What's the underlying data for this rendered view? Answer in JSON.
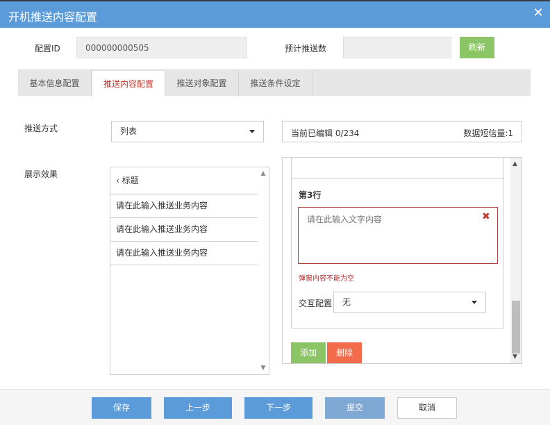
{
  "dialog": {
    "title": "开机推送内容配置"
  },
  "config": {
    "id_label": "配置ID",
    "id_value": "000000000505",
    "estimate_label": "预计推送数",
    "estimate_value": "",
    "refresh_label": "刷新"
  },
  "tabs": [
    {
      "label": "基本信息配置",
      "active": false
    },
    {
      "label": "推送内容配置",
      "active": true
    },
    {
      "label": "推送对象配置",
      "active": false
    },
    {
      "label": "推送条件设定",
      "active": false
    }
  ],
  "push_method": {
    "label": "推送方式",
    "selected": "列表"
  },
  "status": {
    "edited": "当前已编辑 0/234",
    "sms_count": "数据短信量:1"
  },
  "preview": {
    "label": "展示效果",
    "back_title": "‹ 标题",
    "rows": [
      "请在此输入推送业务内容",
      "请在此输入推送业务内容",
      "请在此输入推送业务内容"
    ]
  },
  "editor": {
    "row_title": "第3行",
    "placeholder": "请在此输入文字内容",
    "error": "弹窗内容不能为空",
    "interaction_label": "交互配置",
    "interaction_selected": "无",
    "add_label": "添加",
    "delete_label": "删除"
  },
  "footer": {
    "save": "保存",
    "prev": "上一步",
    "next": "下一步",
    "submit": "提交",
    "cancel": "取消"
  },
  "colors": {
    "titlebar": "#5b9bd9",
    "green_button": "#8cc565",
    "red_button": "#f26b4a",
    "active_tab_text": "#c0392b"
  }
}
